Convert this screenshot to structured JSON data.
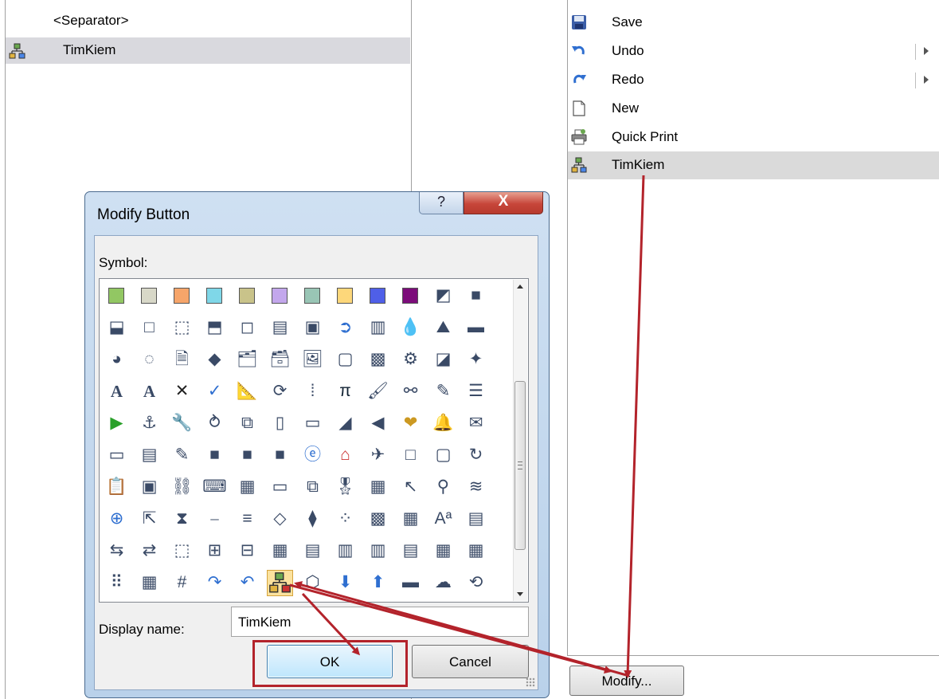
{
  "left_list": {
    "items": [
      {
        "label": "<Separator>",
        "selected": false
      },
      {
        "label": "TimKiem",
        "selected": true,
        "icon": "org-chart-icon"
      }
    ]
  },
  "right_list": {
    "items": [
      {
        "label": "Save",
        "icon": "floppy-disk-icon",
        "submenu": false
      },
      {
        "label": "Undo",
        "icon": "undo-arrow-icon",
        "submenu": true
      },
      {
        "label": "Redo",
        "icon": "redo-arrow-icon",
        "submenu": true
      },
      {
        "label": "New",
        "icon": "blank-page-icon",
        "submenu": false
      },
      {
        "label": "Quick Print",
        "icon": "printer-icon",
        "submenu": false
      },
      {
        "label": "TimKiem",
        "icon": "org-chart-icon",
        "submenu": false,
        "selected": true
      }
    ],
    "modify_button": "Modify..."
  },
  "dialog": {
    "title": "Modify Button",
    "help_label": "?",
    "close_label": "X",
    "symbol_label": "Symbol:",
    "display_name_label": "Display name:",
    "display_name_value": "TimKiem",
    "ok_label": "OK",
    "cancel_label": "Cancel",
    "selected_symbol": "org-chart-icon",
    "colors": {
      "swatches": [
        "#92c763",
        "#d8d8c8",
        "#f6a56a",
        "#7fd7e8",
        "#c9c38a",
        "#c3a7ec",
        "#99c5b5",
        "#fdd77a",
        "#4f5fe8",
        "#7c0c7a"
      ],
      "highlight": "#b3232b",
      "arrow": "#b3232b"
    }
  }
}
